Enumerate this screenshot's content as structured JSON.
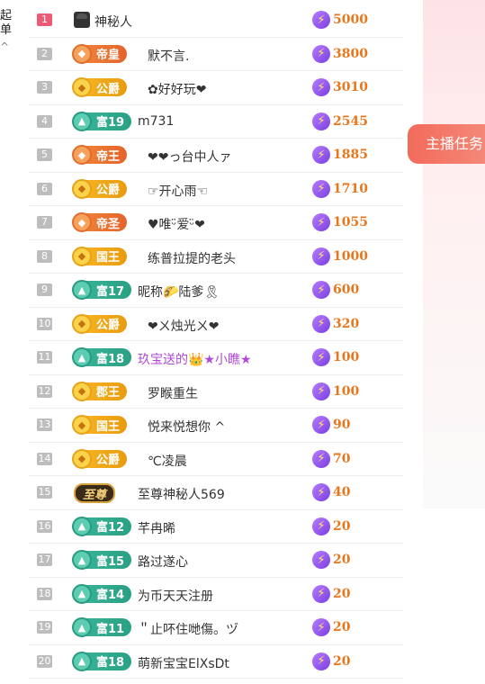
{
  "left_edge": {
    "line1": "起",
    "line2": "单",
    "chevron": "^"
  },
  "side_button": {
    "label": "主播任务"
  },
  "rows": [
    {
      "rank": "1",
      "badge_type": "mystery",
      "badge_text": "",
      "name": "神秘人",
      "name_color": "normal",
      "amount": "5000"
    },
    {
      "rank": "2",
      "badge_type": "orange",
      "badge_text": "帝皇",
      "name": "默不言.",
      "name_color": "normal",
      "amount": "3800"
    },
    {
      "rank": "3",
      "badge_type": "gold",
      "badge_text": "公爵",
      "name": "✿好好玩❤",
      "name_color": "normal",
      "amount": "3010"
    },
    {
      "rank": "4",
      "badge_type": "teal",
      "badge_text": "富19",
      "name": "m731",
      "name_color": "normal",
      "amount": "2545"
    },
    {
      "rank": "5",
      "badge_type": "orange",
      "badge_text": "帝王",
      "name": "❤❤っ台中人ァ",
      "name_color": "normal",
      "amount": "1885"
    },
    {
      "rank": "6",
      "badge_type": "gold",
      "badge_text": "公爵",
      "name": "☞开心雨☜",
      "name_color": "normal",
      "amount": "1710"
    },
    {
      "rank": "7",
      "badge_type": "orange",
      "badge_text": "帝圣",
      "name": "♥唯ᵕ̈爱ᵕ̈❤",
      "name_color": "normal",
      "amount": "1055"
    },
    {
      "rank": "8",
      "badge_type": "gold",
      "badge_text": "国王",
      "name": "练普拉提的老头",
      "name_color": "normal",
      "amount": "1000"
    },
    {
      "rank": "9",
      "badge_type": "teal",
      "badge_text": "富17",
      "name": "昵称🌮陆爹🎗",
      "name_color": "normal",
      "amount": "600"
    },
    {
      "rank": "10",
      "badge_type": "gold",
      "badge_text": "公爵",
      "name": "❤ㄨ烛光ㄨ❤",
      "name_color": "normal",
      "amount": "320"
    },
    {
      "rank": "11",
      "badge_type": "teal",
      "badge_text": "富18",
      "name": "玖宝送的👑★小瞧★",
      "name_color": "purple",
      "amount": "100"
    },
    {
      "rank": "12",
      "badge_type": "gold",
      "badge_text": "郡王",
      "name": "罗睺重生",
      "name_color": "normal",
      "amount": "100"
    },
    {
      "rank": "13",
      "badge_type": "gold",
      "badge_text": "国王",
      "name": "悦来悦想你 ^",
      "name_color": "normal",
      "amount": "90"
    },
    {
      "rank": "14",
      "badge_type": "gold",
      "badge_text": "公爵",
      "name": "℃凌晨",
      "name_color": "normal",
      "amount": "70"
    },
    {
      "rank": "15",
      "badge_type": "special",
      "badge_text": "至尊",
      "name": "至尊神秘人569",
      "name_color": "normal",
      "amount": "40"
    },
    {
      "rank": "16",
      "badge_type": "teal",
      "badge_text": "富12",
      "name": "芊冉晞",
      "name_color": "normal",
      "amount": "20"
    },
    {
      "rank": "17",
      "badge_type": "teal",
      "badge_text": "富15",
      "name": "路过遂心",
      "name_color": "normal",
      "amount": "20"
    },
    {
      "rank": "18",
      "badge_type": "teal",
      "badge_text": "富14",
      "name": "为币天天注册",
      "name_color": "normal",
      "amount": "20"
    },
    {
      "rank": "19",
      "badge_type": "teal",
      "badge_text": "富11",
      "name": "＂止吥住哋傷。ヅ",
      "name_color": "normal",
      "amount": "20"
    },
    {
      "rank": "20",
      "badge_type": "teal",
      "badge_text": "富18",
      "name": "萌新宝宝ElXsDt",
      "name_color": "normal",
      "amount": "20"
    }
  ]
}
